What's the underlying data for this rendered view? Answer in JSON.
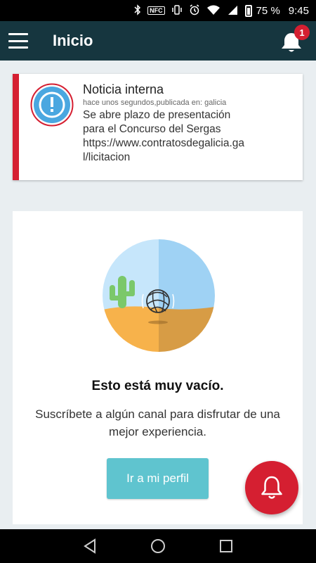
{
  "status_bar": {
    "battery": "75 %",
    "time": "9:45",
    "nfc": "NFC",
    "icons": [
      "bluetooth-icon",
      "nfc-icon",
      "vibrate-icon",
      "alarm-icon",
      "wifi-icon",
      "signal-icon",
      "battery-icon"
    ]
  },
  "app_bar": {
    "title": "Inicio",
    "notification_count": "1"
  },
  "notice": {
    "title": "Noticia interna",
    "meta": "hace unos segundos,publicada en: galicia",
    "text": "Se abre plazo de presentación\npara el Concurso del Sergas\nhttps://www.contratosdegalicia.ga\nl/licitacion"
  },
  "empty_state": {
    "title": "Esto está muy vacío.",
    "subtitle": "Suscríbete a algún canal para disfrutar de una mejor experiencia.",
    "button": "Ir a mi perfil"
  },
  "colors": {
    "app_bar": "#16363f",
    "accent_red": "#d51f31",
    "button_teal": "#5fc4cf",
    "background": "#e9eef1"
  }
}
